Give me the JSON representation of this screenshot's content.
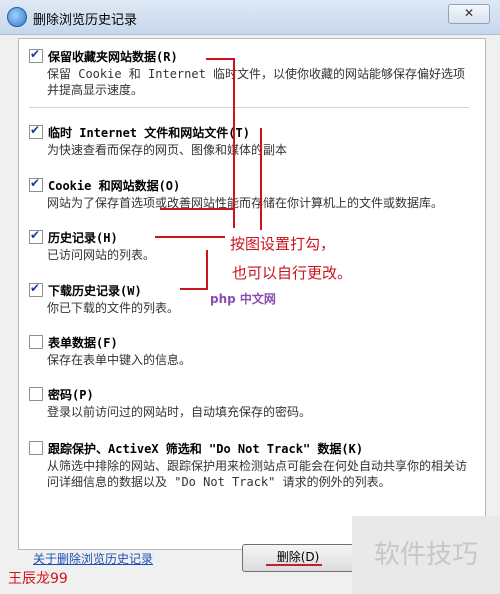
{
  "window": {
    "title": "删除浏览历史记录",
    "close": "✕"
  },
  "options": [
    {
      "title": "保留收藏夹网站数据(R)",
      "desc": "保留 Cookie 和 Internet 临时文件，以使你收藏的网站能够保存偏好选项并提高显示速度。",
      "checked": true
    },
    {
      "title": "临时 Internet 文件和网站文件(T)",
      "desc": "为快速查看而保存的网页、图像和媒体的副本",
      "checked": true
    },
    {
      "title": "Cookie 和网站数据(O)",
      "desc": "网站为了保存首选项或改善网站性能而存储在你计算机上的文件或数据库。",
      "checked": true
    },
    {
      "title": "历史记录(H)",
      "desc": "已访问网站的列表。",
      "checked": true
    },
    {
      "title": "下载历史记录(W)",
      "desc": "你已下载的文件的列表。",
      "checked": true
    },
    {
      "title": "表单数据(F)",
      "desc": "保存在表单中键入的信息。",
      "checked": false
    },
    {
      "title": "密码(P)",
      "desc": "登录以前访问过的网站时，自动填充保存的密码。",
      "checked": false
    },
    {
      "title": "跟踪保护、ActiveX 筛选和 \"Do Not Track\" 数据(K)",
      "desc": "从筛选中排除的网站、跟踪保护用来检测站点可能会在何处自动共享你的相关访问详细信息的数据以及 \"Do Not Track\" 请求的例外的列表。",
      "checked": false
    }
  ],
  "footer": {
    "link": "关于删除浏览历史记录",
    "delete_button": "删除(D)"
  },
  "annotation": {
    "line1": "按图设置打勾，",
    "line2": "也可以自行更改。"
  },
  "watermarks": {
    "php": "php 中文网",
    "right": "软件技巧",
    "author": "王辰龙99"
  },
  "colors": {
    "annotation_red": "#c8141e",
    "link_blue": "#1a50b4"
  }
}
